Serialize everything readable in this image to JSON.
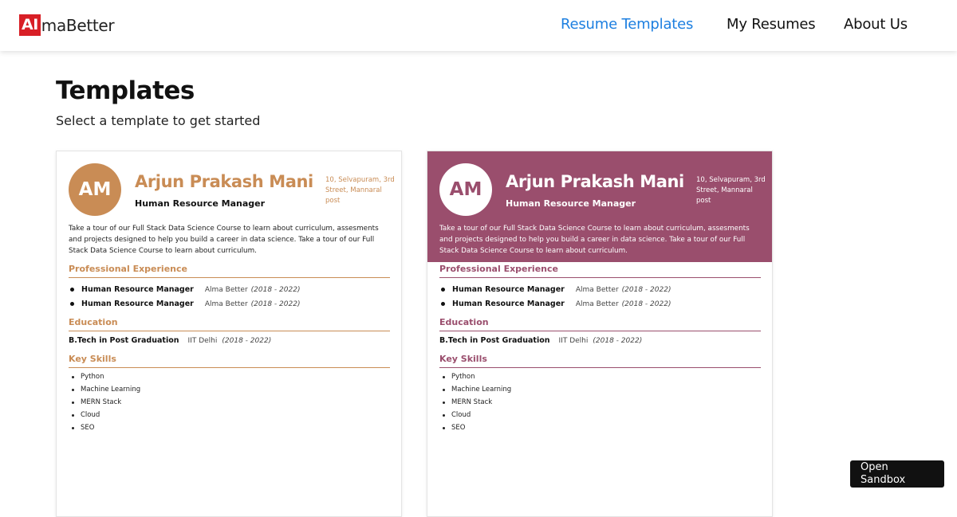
{
  "header": {
    "logo_badge": "AI",
    "logo_text": "maBetter",
    "nav": [
      "Resume Templates",
      "My Resumes",
      "About Us"
    ],
    "active_color": "#1d7fe0"
  },
  "main": {
    "title": "Templates",
    "subtitle": "Select a template to get started"
  },
  "resume": {
    "initials": "AM",
    "name": "Arjun Prakash Mani",
    "role": "Human Resource Manager",
    "address": "10, Selvapuram, 3rd Street, Mannaral post",
    "summary": "Take a tour of our Full Stack Data Science Course to learn about curriculum, assesments and projects designed to help you build a career in data science. Take a tour of our Full Stack Data Science Course to learn about curriculum.",
    "sections": {
      "experience": "Professional Experience",
      "education": "Education",
      "skills": "Key Skills"
    },
    "experience": [
      {
        "role": "Human Resource Manager",
        "company": "Alma Better",
        "dates": "(2018 - 2022)"
      },
      {
        "role": "Human Resource Manager",
        "company": "Alma Better",
        "dates": "(2018 - 2022)"
      }
    ],
    "education": {
      "degree": "B.Tech in Post Graduation",
      "school": "IIT Delhi",
      "dates": "(2018 - 2022)"
    },
    "skills": [
      "Python",
      "Machine Learning",
      "MERN Stack",
      "Cloud",
      "SEO"
    ]
  },
  "templates": [
    {
      "name": "orange-template",
      "accent": "#c98c55"
    },
    {
      "name": "plum-template",
      "accent": "#9a4e6d"
    }
  ],
  "sandbox_button": "Open Sandbox"
}
